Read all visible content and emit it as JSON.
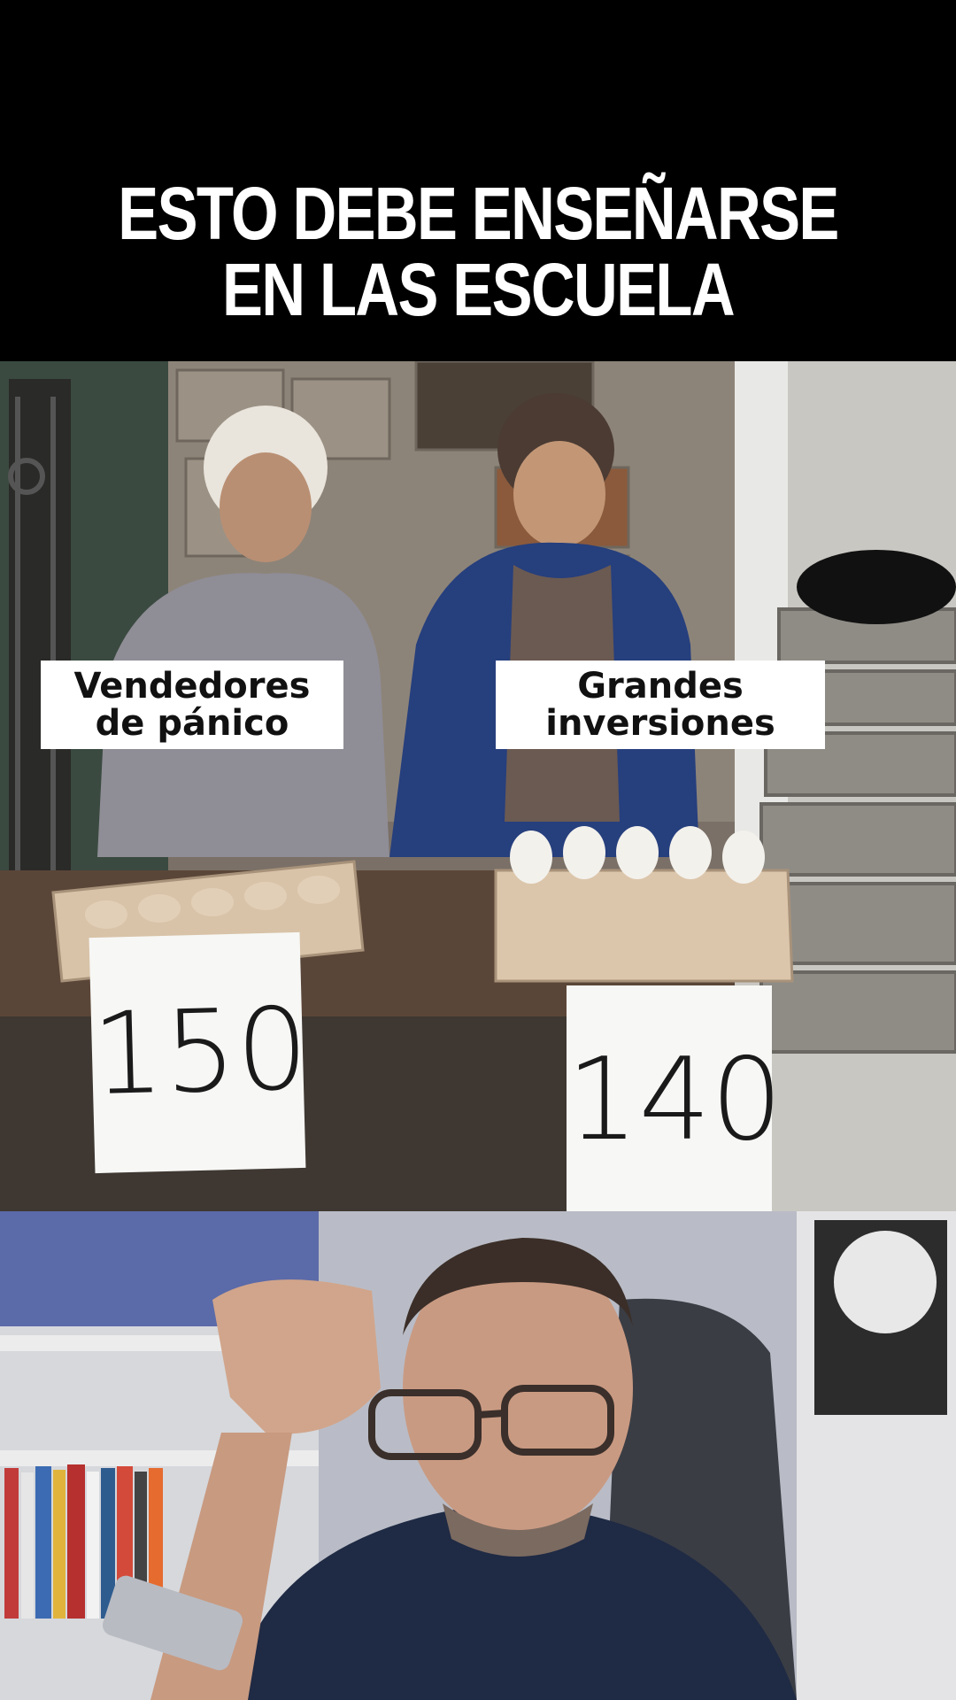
{
  "headline": {
    "line1": "ESTO DEBE ENSEÑARSE",
    "line2": "EN LAS ESCUELA"
  },
  "labels": {
    "left": {
      "line1": "Vendedores",
      "line2": "de pánico"
    },
    "right": {
      "line1": "Grandes",
      "line2": "inversiones"
    }
  },
  "prices": {
    "left": "150",
    "right": "140"
  },
  "colors": {
    "background": "#000000",
    "headline_text": "#ffffff",
    "label_bg": "#ffffff"
  }
}
